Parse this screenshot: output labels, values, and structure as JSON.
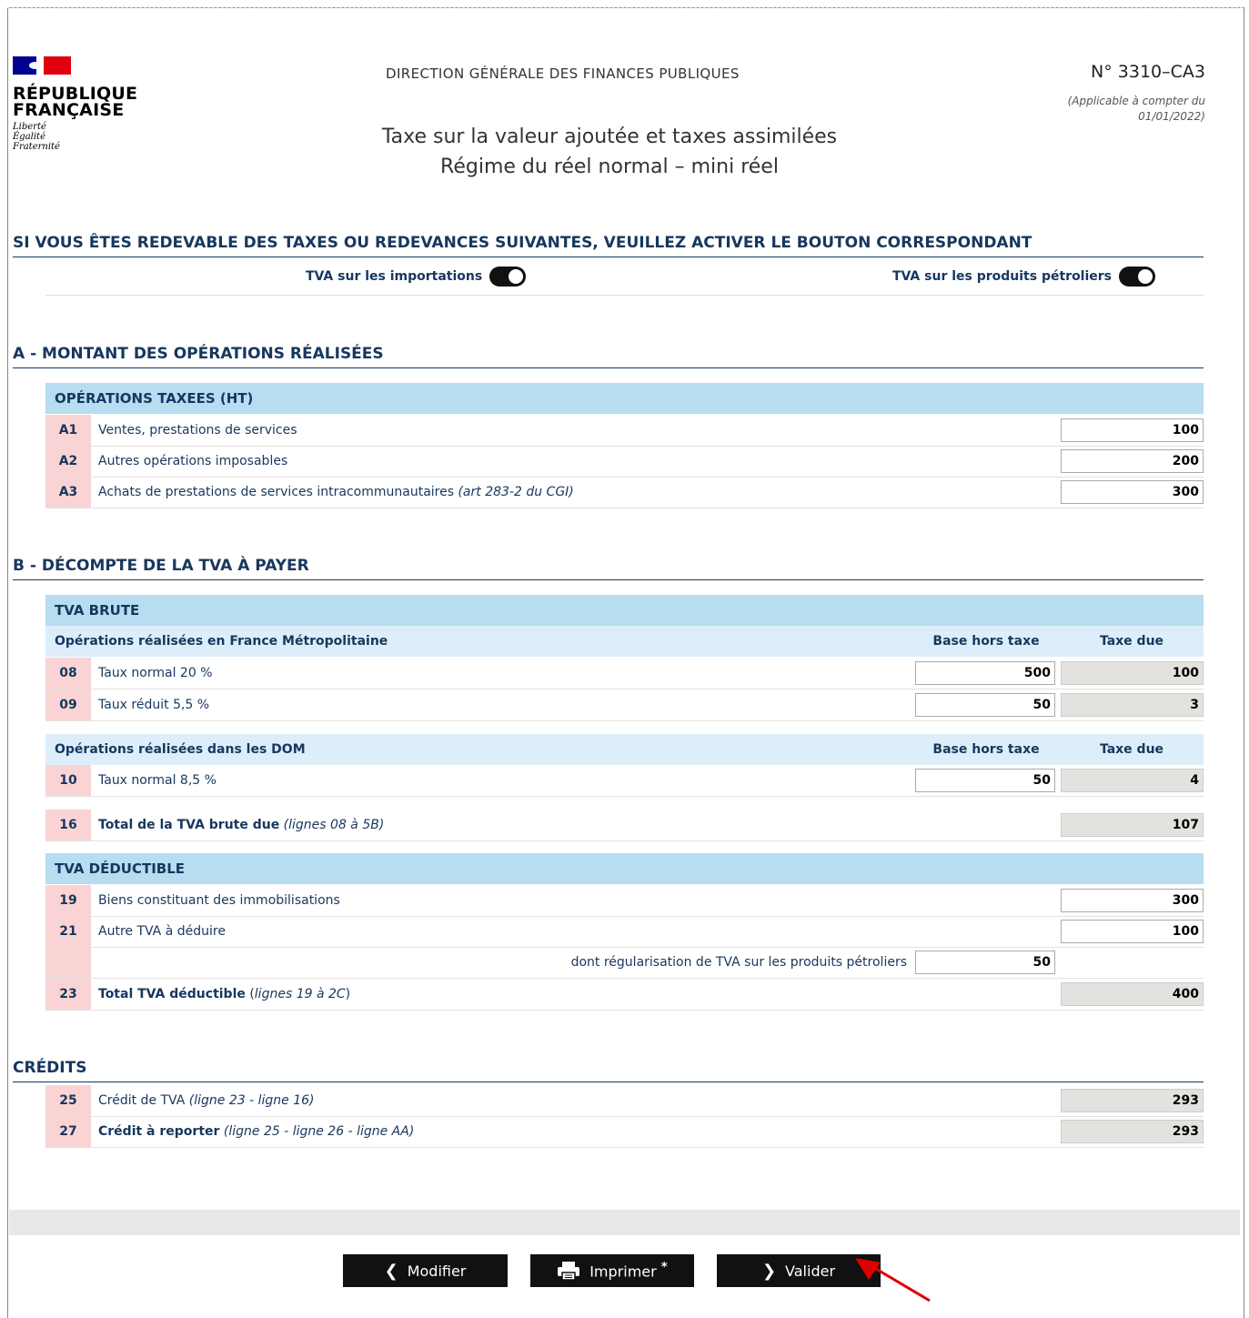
{
  "header": {
    "rf_line1": "RÉPUBLIQUE",
    "rf_line2": "FRANÇAISE",
    "devise": [
      "Liberté",
      "Égalité",
      "Fraternité"
    ],
    "dgfip": "DIRECTION GÉNÉRALE DES FINANCES PUBLIQUES",
    "form_number": "N° 3310–CA3",
    "applicability_line1": "(Applicable à compter du",
    "applicability_line2": "01/01/2022)",
    "title_line1": "Taxe sur la valeur ajoutée et taxes assimilées",
    "title_line2": "Régime du réel normal – mini réel"
  },
  "taxes": {
    "heading": "SI VOUS ÊTES REDEVABLE DES TAXES OU REDEVANCES SUIVANTES, VEUILLEZ ACTIVER LE BOUTON CORRESPONDANT",
    "toggle_imports": "TVA sur les importations",
    "toggle_petrol": "TVA sur les produits pétroliers"
  },
  "sectionA": {
    "heading": "A - MONTANT DES OPÉRATIONS RÉALISÉES",
    "band": "OPÉRATIONS TAXEES (HT)",
    "rows": [
      {
        "code": "A1",
        "label": "Ventes, prestations de services",
        "value": "100"
      },
      {
        "code": "A2",
        "label": "Autres opérations imposables",
        "value": "200"
      },
      {
        "code": "A3",
        "label": "Achats de prestations de services intracommunautaires",
        "note": "(art 283-2 du CGI)",
        "value": "300"
      }
    ]
  },
  "sectionB": {
    "heading": "B - DÉCOMPTE DE LA TVA À PAYER",
    "band_brute": "TVA BRUTE",
    "sub_metro": "Opérations réalisées en France Métropolitaine",
    "sub_dom": "Opérations réalisées dans les DOM",
    "col_base": "Base hors taxe",
    "col_tax": "Taxe due",
    "rows_metro": [
      {
        "code": "08",
        "label": "Taux normal 20 %",
        "base": "500",
        "tax": "100"
      },
      {
        "code": "09",
        "label": "Taux réduit 5,5 %",
        "base": "50",
        "tax": "3"
      }
    ],
    "rows_dom": [
      {
        "code": "10",
        "label": "Taux normal 8,5 %",
        "base": "50",
        "tax": "4"
      }
    ],
    "total_brute": {
      "code": "16",
      "label": "Total de la TVA brute due",
      "note": "(lignes 08 à 5B)",
      "value": "107"
    },
    "band_deductible": "TVA DÉDUCTIBLE",
    "rows_deductible": [
      {
        "code": "19",
        "label": "Biens constituant des immobilisations",
        "value": "300"
      },
      {
        "code": "21",
        "label": "Autre TVA à déduire",
        "value": "100"
      }
    ],
    "regul": {
      "label": "dont régularisation de TVA sur les produits pétroliers",
      "value": "50"
    },
    "total_deductible": {
      "code": "23",
      "label": "Total TVA déductible",
      "note_open": "(",
      "note": "lignes 19 à 2C",
      "note_close": ")",
      "value": "400"
    }
  },
  "credits": {
    "heading": "CRÉDITS",
    "rows": [
      {
        "code": "25",
        "label": "Crédit de TVA",
        "note": "(ligne 23 - ligne 16)",
        "value": "293"
      },
      {
        "code": "27",
        "label": "Crédit à reporter",
        "note": "(ligne 25 - ligne 26 - ligne AA)",
        "value": "293"
      }
    ]
  },
  "buttons": {
    "modify": "Modifier",
    "print": "Imprimer",
    "print_star": "*",
    "validate": "Valider"
  },
  "colors": {
    "navy": "#17375e",
    "band": "#b8dcf0",
    "code_bg": "#fad4d4",
    "arrow": "#e00000"
  }
}
